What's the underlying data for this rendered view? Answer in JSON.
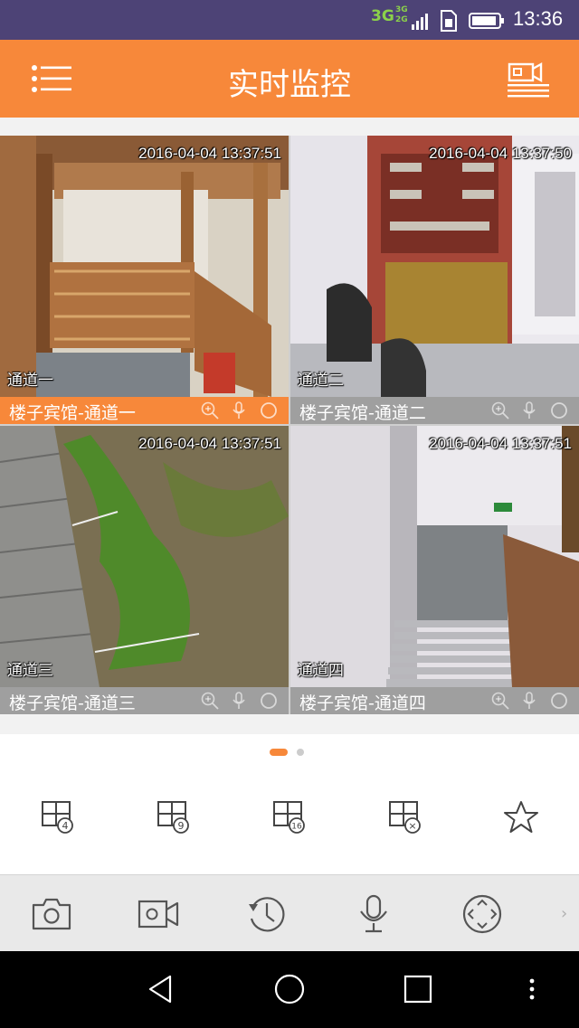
{
  "status_bar": {
    "network_primary": "3G",
    "network_secondary_top": "3G",
    "network_secondary_bottom": "2G",
    "time": "13:36",
    "icons": [
      "signal-icon",
      "sim-card-icon",
      "battery-icon"
    ]
  },
  "header": {
    "title": "实时监控",
    "left_icon": "menu-list-icon",
    "right_icon": "recording-list-icon"
  },
  "tiles": [
    {
      "timestamp": "2016-04-04 13:37:51",
      "channel": "通道一",
      "name": "楼子宾馆-通道一",
      "selected": true
    },
    {
      "timestamp": "2016-04-04 13:37:50",
      "channel": "通道二",
      "name": "楼子宾馆-通道二",
      "selected": false
    },
    {
      "timestamp": "2016-04-04 13:37:51",
      "channel": "通道三",
      "name": "楼子宾馆-通道三",
      "selected": false
    },
    {
      "timestamp": "2016-04-04 13:37:51",
      "channel": "通道四",
      "name": "楼子宾馆-通道四",
      "selected": false
    }
  ],
  "tile_bar_icons": [
    "zoom-icon",
    "microphone-icon",
    "record-circle-icon"
  ],
  "pager": {
    "pages": 2,
    "current": 1
  },
  "layout_options": [
    {
      "icon": "grid-4-icon",
      "label": "4"
    },
    {
      "icon": "grid-9-icon",
      "label": "9"
    },
    {
      "icon": "grid-16-icon",
      "label": "16"
    },
    {
      "icon": "grid-close-icon",
      "label": "×"
    },
    {
      "icon": "favorite-star-icon",
      "label": ""
    }
  ],
  "toolbar": [
    "snapshot-camera-icon",
    "video-record-icon",
    "playback-history-icon",
    "talk-microphone-icon",
    "ptz-direction-icon"
  ],
  "toolbar_more": "›",
  "colors": {
    "accent": "#f7883a",
    "status_bar": "#4d4376",
    "toolbar": "#e9e9e9"
  }
}
